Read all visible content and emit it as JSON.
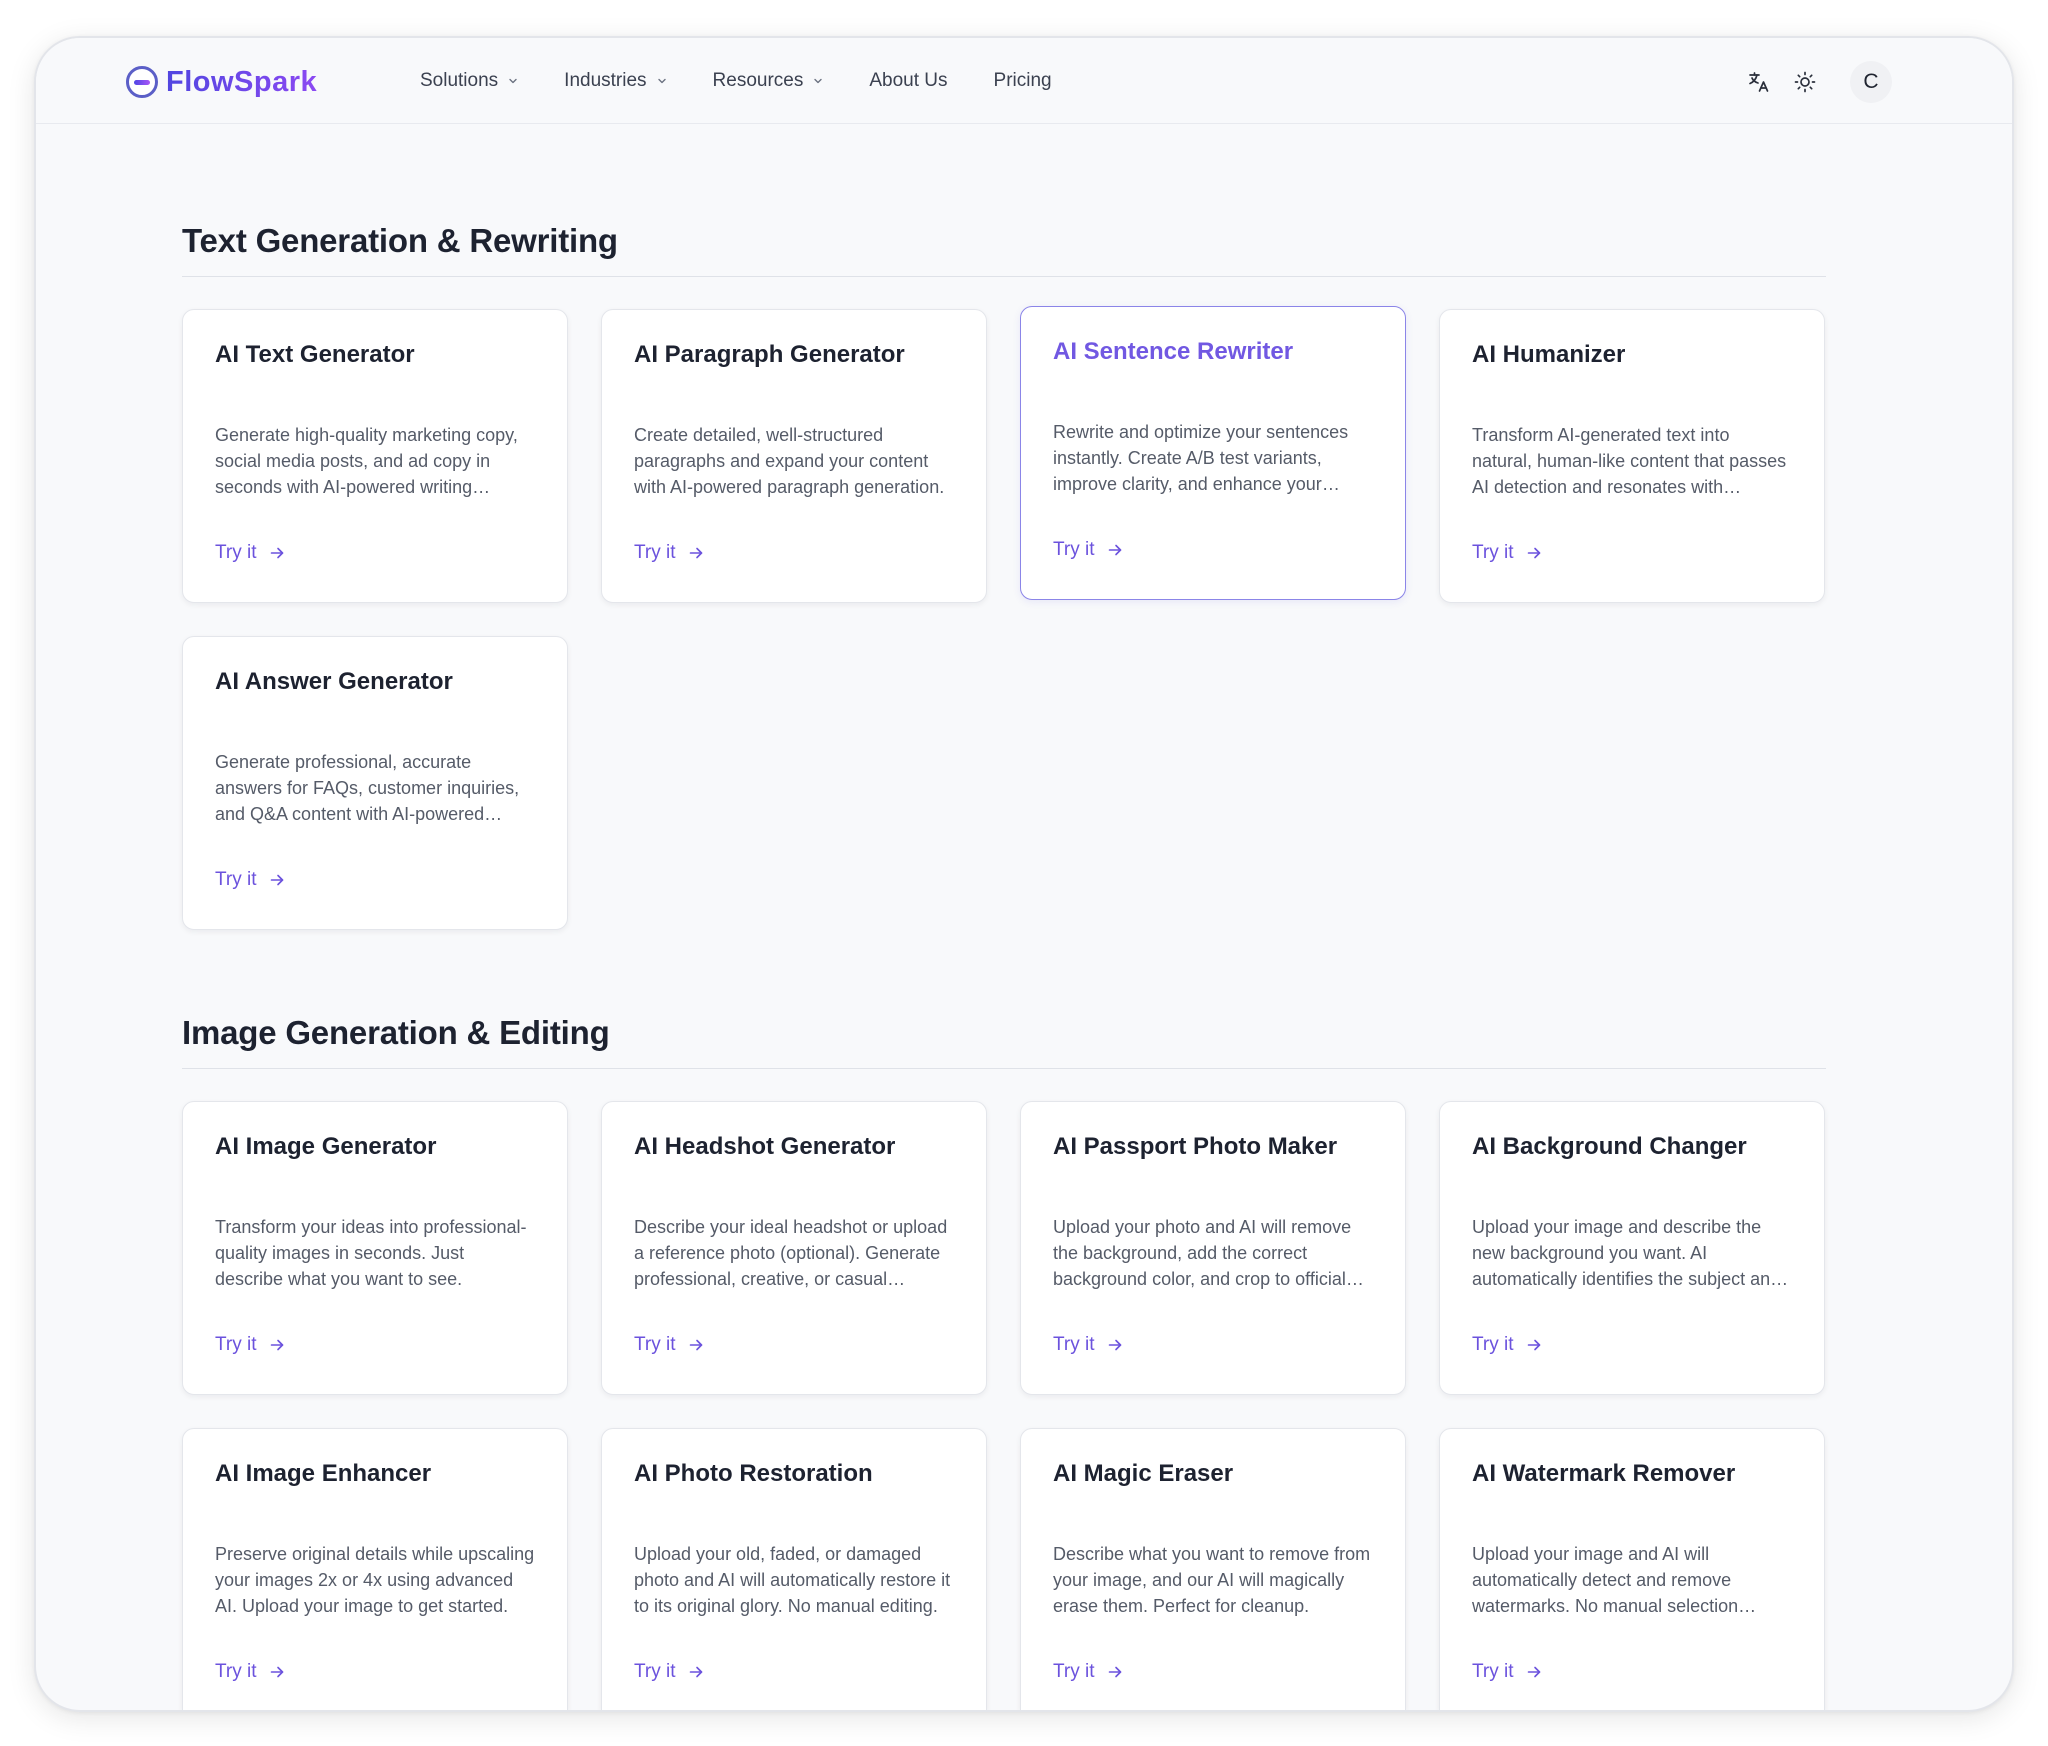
{
  "brand": {
    "name": "FlowSpark"
  },
  "nav": {
    "items": [
      {
        "label": "Solutions",
        "dropdown": true
      },
      {
        "label": "Industries",
        "dropdown": true
      },
      {
        "label": "Resources",
        "dropdown": true
      },
      {
        "label": "About Us",
        "dropdown": false
      },
      {
        "label": "Pricing",
        "dropdown": false
      }
    ]
  },
  "header_actions": {
    "language_icon": "translate-icon",
    "theme_icon": "sun-icon",
    "avatar_initial": "C"
  },
  "colors": {
    "accent": "#6b52dd",
    "active_border": "#8b85e8",
    "background": "#f8f9fb"
  },
  "sections": [
    {
      "title": "Text Generation & Rewriting",
      "cards": [
        {
          "title": "AI Text Generator",
          "desc": "Generate high-quality marketing copy, social media posts, and ad copy in seconds with AI-powered writing assistance.",
          "cta": "Try it"
        },
        {
          "title": "AI Paragraph Generator",
          "desc": "Create detailed, well-structured paragraphs and expand your content with AI-powered paragraph generation.",
          "cta": "Try it"
        },
        {
          "title": "AI Sentence Rewriter",
          "desc": "Rewrite and optimize your sentences instantly. Create A/B test variants, improve clarity, and enhance your writing style.",
          "cta": "Try it",
          "active": true
        },
        {
          "title": "AI Humanizer",
          "desc": "Transform AI-generated text into natural, human-like content that passes AI detection and resonates with readers.",
          "cta": "Try it"
        },
        {
          "title": "AI Answer Generator",
          "desc": "Generate professional, accurate answers for FAQs, customer inquiries, and Q&A content with AI-powered responses.",
          "cta": "Try it"
        }
      ]
    },
    {
      "title": "Image Generation & Editing",
      "cards": [
        {
          "title": "AI Image Generator",
          "desc": "Transform your ideas into professional-quality images in seconds. Just describe what you want to see.",
          "cta": "Try it"
        },
        {
          "title": "AI Headshot Generator",
          "desc": "Describe your ideal headshot or upload a reference photo (optional). Generate professional, creative, or casual portraits.",
          "cta": "Try it"
        },
        {
          "title": "AI Passport Photo Maker",
          "desc": "Upload your photo and AI will remove the background, add the correct background color, and crop to official size.",
          "cta": "Try it"
        },
        {
          "title": "AI Background Changer",
          "desc": "Upload your image and describe the new background you want. AI automatically identifies the subject and replaces it.",
          "cta": "Try it"
        },
        {
          "title": "AI Image Enhancer",
          "desc": "Preserve original details while upscaling your images 2x or 4x using advanced AI. Upload your image to get started.",
          "cta": "Try it"
        },
        {
          "title": "AI Photo Restoration",
          "desc": "Upload your old, faded, or damaged photo and AI will automatically restore it to its original glory. No manual editing.",
          "cta": "Try it"
        },
        {
          "title": "AI Magic Eraser",
          "desc": "Describe what you want to remove from your image, and our AI will magically erase them. Perfect for cleanup.",
          "cta": "Try it"
        },
        {
          "title": "AI Watermark Remover",
          "desc": "Upload your image and AI will automatically detect and remove watermarks. No manual selection needed.",
          "cta": "Try it"
        }
      ]
    }
  ]
}
